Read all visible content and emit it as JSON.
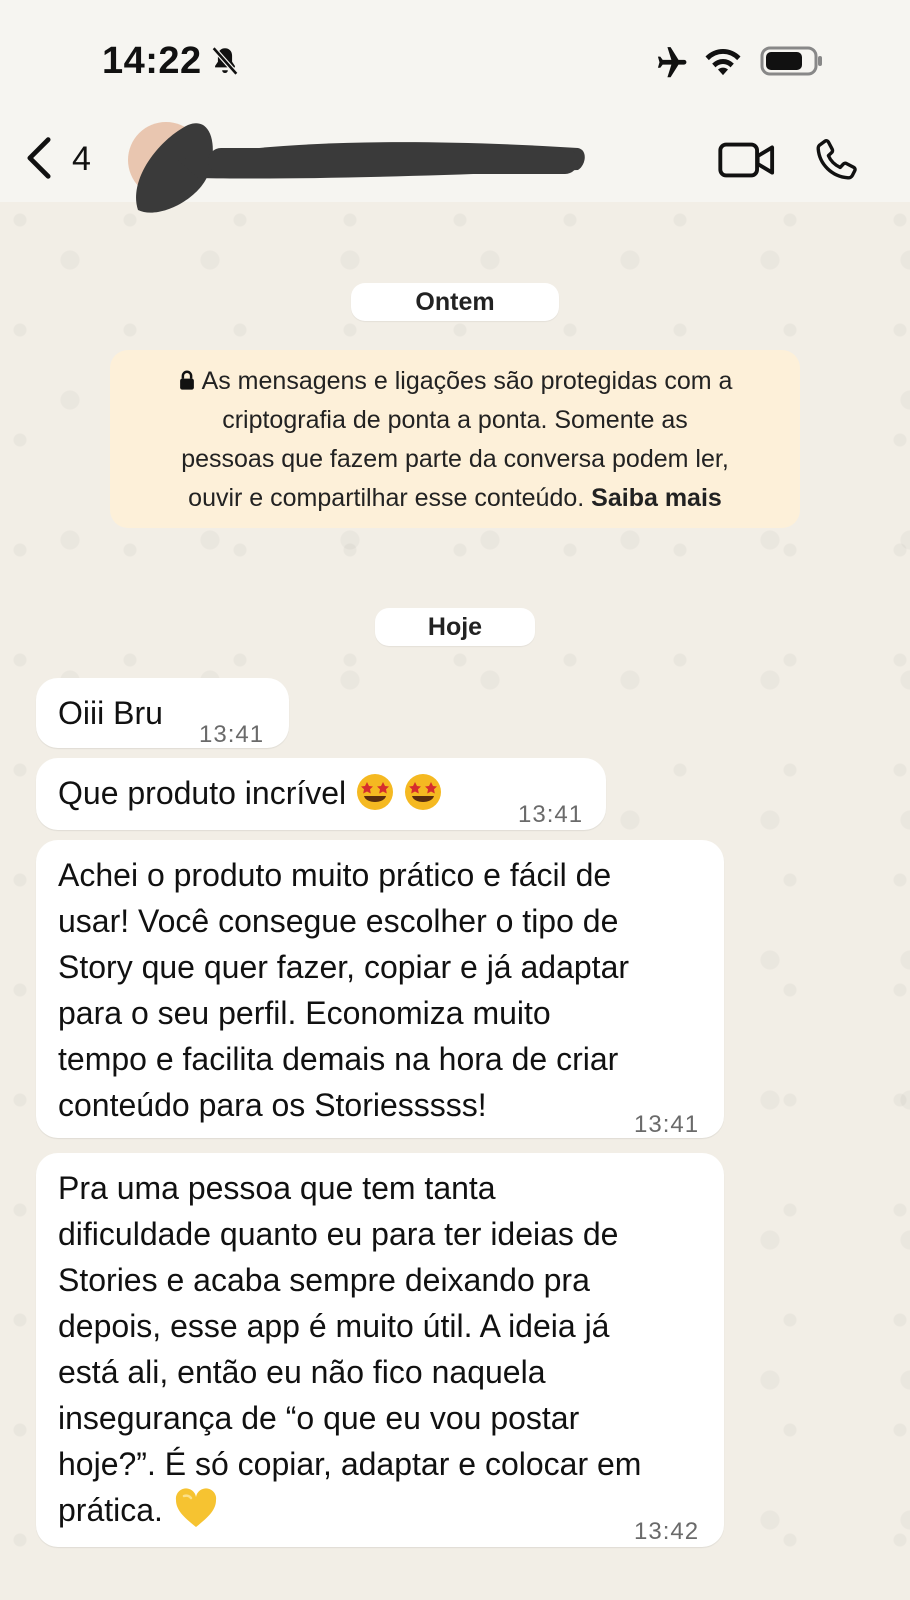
{
  "status_bar": {
    "time": "14:22",
    "icons": [
      "bell-slash-icon",
      "airplane-icon",
      "wifi-icon",
      "battery-icon"
    ]
  },
  "header": {
    "back_count": "4",
    "icons": [
      "chevron-left-icon",
      "video-call-icon",
      "phone-call-icon"
    ]
  },
  "chat": {
    "date_yesterday": "Ontem",
    "encryption_notice": {
      "lines": [
        "As mensagens e ligações são protegidas com a",
        "criptografia de ponta a ponta. Somente as",
        "pessoas que fazem parte da conversa podem ler,",
        "ouvir e compartilhar esse conteúdo."
      ],
      "link": "Saiba mais"
    },
    "date_today": "Hoje",
    "messages": [
      {
        "lines": [
          "Oiii Bru"
        ],
        "time": "13:41"
      },
      {
        "lines": [
          "Que produto incrível"
        ],
        "emoji": "star-struck-icon",
        "time": "13:41"
      },
      {
        "lines": [
          "Achei o produto muito prático e fácil de",
          "usar! Você consegue escolher o tipo de",
          "Story que quer fazer, copiar e já adaptar",
          "para o seu perfil. Economiza muito",
          "tempo e facilita demais na hora de criar",
          "conteúdo para os Storiesssss!"
        ],
        "time": "13:41"
      },
      {
        "lines": [
          "Pra uma pessoa que tem tanta",
          "dificuldade quanto eu para ter ideias de",
          "Stories e acaba sempre deixando pra",
          "depois, esse app é muito útil. A ideia já",
          "está ali, então eu não fico naquela",
          "insegurança de “o que eu vou postar",
          "hoje?”. É só copiar, adaptar e colocar em",
          "prática."
        ],
        "emoji": "yellow-heart-icon",
        "time": "13:42"
      }
    ]
  },
  "colors": {
    "wallpaper": "#f2eee6",
    "bubble": "#ffffff",
    "notice": "#fdf0d9",
    "timestamp": "#6a6a6a"
  }
}
